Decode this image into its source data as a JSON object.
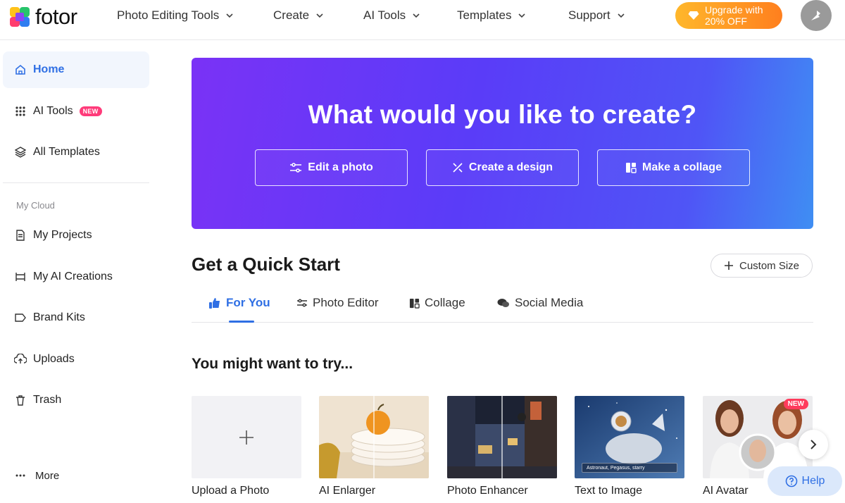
{
  "header": {
    "logo_text": "fotor",
    "nav": [
      {
        "label": "Photo Editing Tools"
      },
      {
        "label": "Create"
      },
      {
        "label": "AI Tools"
      },
      {
        "label": "Templates"
      },
      {
        "label": "Support"
      }
    ],
    "upgrade_line1": "Upgrade with",
    "upgrade_line2": "20% OFF"
  },
  "sidebar": {
    "items": [
      {
        "label": "Home",
        "icon": "home-icon"
      },
      {
        "label": "AI Tools",
        "icon": "grid-dots-icon",
        "badge": "NEW"
      },
      {
        "label": "All Templates",
        "icon": "layers-icon"
      }
    ],
    "section_label": "My Cloud",
    "cloud_items": [
      {
        "label": "My Projects",
        "icon": "document-icon"
      },
      {
        "label": "My AI Creations",
        "icon": "ai-frame-icon"
      },
      {
        "label": "Brand Kits",
        "icon": "tag-icon"
      },
      {
        "label": "Uploads",
        "icon": "cloud-upload-icon"
      },
      {
        "label": "Trash",
        "icon": "trash-icon"
      }
    ],
    "more_label": "More"
  },
  "hero": {
    "title": "What would you like to create?",
    "buttons": [
      {
        "label": "Edit a photo",
        "icon": "sliders-icon"
      },
      {
        "label": "Create a design",
        "icon": "pen-ruler-icon"
      },
      {
        "label": "Make a collage",
        "icon": "collage-icon"
      }
    ]
  },
  "quick_start": {
    "title": "Get a Quick Start",
    "custom_size": "Custom Size",
    "tabs": [
      {
        "label": "For You",
        "icon": "thumbs-up-icon"
      },
      {
        "label": "Photo Editor",
        "icon": "sliders-icon"
      },
      {
        "label": "Collage",
        "icon": "collage-icon"
      },
      {
        "label": "Social Media",
        "icon": "chat-bubbles-icon"
      }
    ]
  },
  "suggestions": {
    "title": "You might want to try...",
    "cards": [
      {
        "label": "Upload a Photo"
      },
      {
        "label": "AI Enlarger"
      },
      {
        "label": "Photo Enhancer"
      },
      {
        "label": "Text to Image",
        "caption": "Astronaut, Pegasus, starry"
      },
      {
        "label": "AI Avatar",
        "badge": "NEW"
      }
    ]
  },
  "help_label": "Help"
}
